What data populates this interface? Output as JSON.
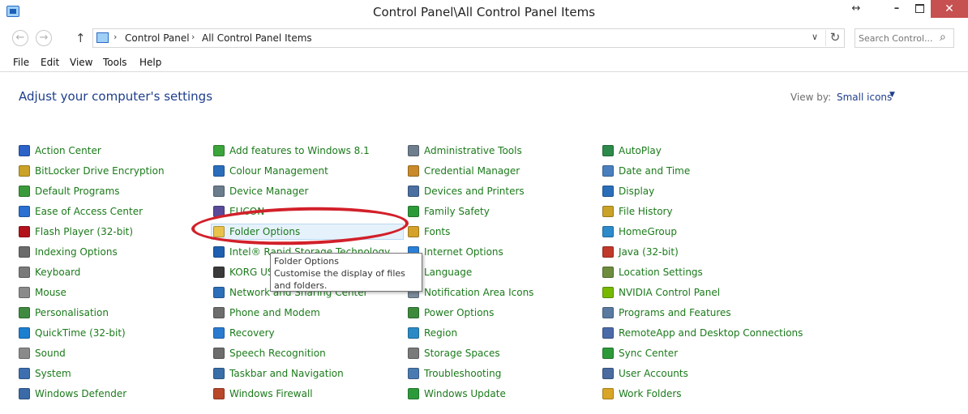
{
  "window": {
    "title": "Control Panel\\All Control Panel Items",
    "resize_glyph": "↔",
    "minimize_glyph": "–",
    "close_glyph": "✕"
  },
  "nav": {
    "back_glyph": "←",
    "forward_glyph": "→",
    "up_glyph": "↑",
    "breadcrumb": [
      "Control Panel",
      "All Control Panel Items"
    ],
    "separator_glyph": "›",
    "dropdown_glyph": "∨",
    "refresh_glyph": "↻",
    "search_placeholder": "Search Control...",
    "search_glyph": "⌕"
  },
  "menu": [
    "File",
    "Edit",
    "View",
    "Tools",
    "Help"
  ],
  "content": {
    "heading": "Adjust your computer's settings",
    "view_by_label": "View by:",
    "view_by_value": "Small icons",
    "view_by_arrow": "▼"
  },
  "columns": [
    [
      "Action Center",
      "BitLocker Drive Encryption",
      "Default Programs",
      "Ease of Access Center",
      "Flash Player (32-bit)",
      "Indexing Options",
      "Keyboard",
      "Mouse",
      "Personalisation",
      "QuickTime (32-bit)",
      "Sound",
      "System",
      "Windows Defender"
    ],
    [
      "Add features to Windows 8.1",
      "Colour Management",
      "Device Manager",
      "EUCON",
      "Folder Options",
      "Intel® Rapid Storage Technology",
      "KORG USB-MIDI Driver Tools",
      "Network and Sharing Center",
      "Phone and Modem",
      "Recovery",
      "Speech Recognition",
      "Taskbar and Navigation",
      "Windows Firewall"
    ],
    [
      "Administrative Tools",
      "Credential Manager",
      "Devices and Printers",
      "Family Safety",
      "Fonts",
      "Internet Options",
      "Language",
      "Notification Area Icons",
      "Power Options",
      "Region",
      "Storage Spaces",
      "Troubleshooting",
      "Windows Update"
    ],
    [
      "AutoPlay",
      "Date and Time",
      "Display",
      "File History",
      "HomeGroup",
      "Java (32-bit)",
      "Location Settings",
      "NVIDIA Control Panel",
      "Programs and Features",
      "RemoteApp and Desktop Connections",
      "Sync Center",
      "User Accounts",
      "Work Folders"
    ]
  ],
  "icon_colors": [
    [
      "#2b63c8",
      "#c9a227",
      "#3a9a3a",
      "#2a6fd1",
      "#b3121b",
      "#6b6b6b",
      "#7a7a7a",
      "#8a8a8a",
      "#3f8a3f",
      "#1c7fd0",
      "#8a8a8a",
      "#3d6fb0",
      "#3b6aa8"
    ],
    [
      "#3ba53b",
      "#2a6dbb",
      "#6b7c8c",
      "#5a4a9a",
      "#e8c24a",
      "#1f5fb0",
      "#3a3a3a",
      "#2d6fb8",
      "#6d6d6d",
      "#2a7ad0",
      "#6d6d6d",
      "#3a6ea8",
      "#b9472a"
    ],
    [
      "#6e7e8e",
      "#c88a2a",
      "#4a6fa0",
      "#2d9a3a",
      "#d4a22a",
      "#2a7fd6",
      "#3a6fc0",
      "#7a8a9a",
      "#3d8a3d",
      "#2a8ac6",
      "#7a7a7a",
      "#4a7ab0",
      "#2d9a3a"
    ],
    [
      "#2d8a4a",
      "#4a7fbf",
      "#2a6dbb",
      "#c9a227",
      "#2d8acb",
      "#c0392b",
      "#6d8c3d",
      "#76b900",
      "#5a7aa0",
      "#4a6aa8",
      "#2d9a3a",
      "#4a6aa0",
      "#d9a526"
    ]
  ],
  "highlighted_item": "Folder Options",
  "tooltip": {
    "title": "Folder Options",
    "body": "Customise the display of files and folders."
  }
}
